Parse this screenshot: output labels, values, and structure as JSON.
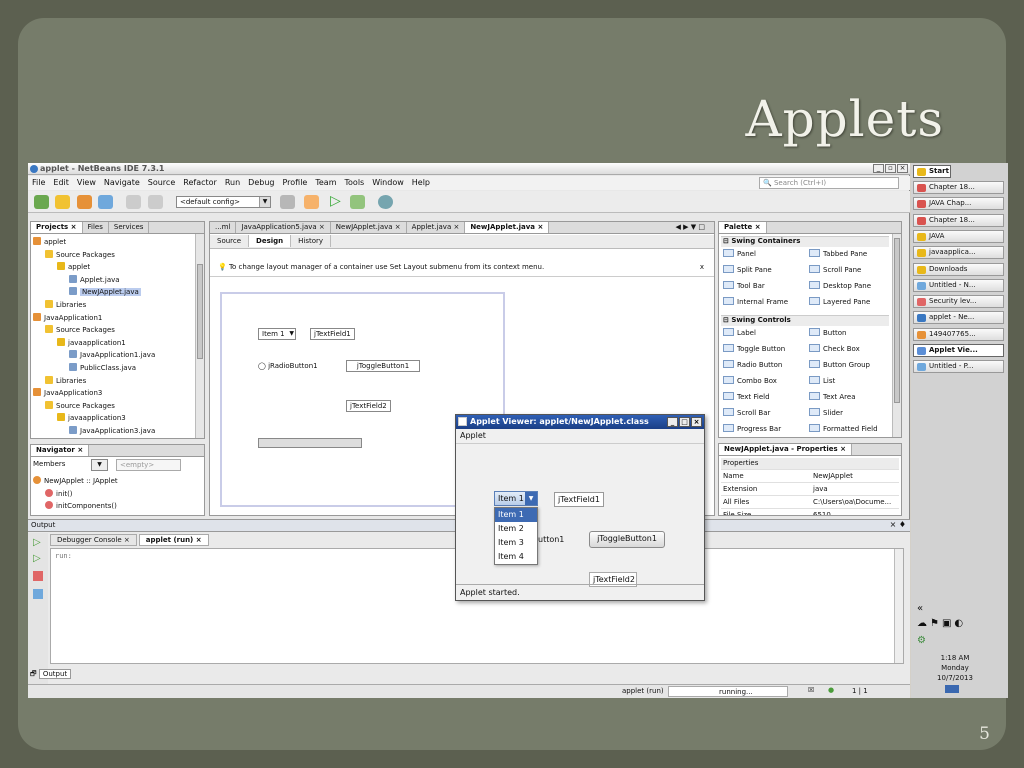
{
  "slide": {
    "title": "Applets",
    "page_number": "5"
  },
  "ide": {
    "window_title": "applet - NetBeans IDE 7.3.1",
    "menu": [
      "File",
      "Edit",
      "View",
      "Navigate",
      "Source",
      "Refactor",
      "Run",
      "Debug",
      "Profile",
      "Team",
      "Tools",
      "Window",
      "Help"
    ],
    "search_placeholder": "Search (Ctrl+I)",
    "config_value": "<default config>",
    "projects": {
      "tabs": [
        "Projects ×",
        "Files",
        "Services"
      ],
      "tree": [
        {
          "label": "applet",
          "depth": 0
        },
        {
          "label": "Source Packages",
          "depth": 1
        },
        {
          "label": "applet",
          "depth": 2
        },
        {
          "label": "Applet.java",
          "depth": 3
        },
        {
          "label": "NewJApplet.java",
          "depth": 3,
          "selected": true
        },
        {
          "label": "Libraries",
          "depth": 1
        },
        {
          "label": "JavaApplication1",
          "depth": 0
        },
        {
          "label": "Source Packages",
          "depth": 1
        },
        {
          "label": "javaapplication1",
          "depth": 2
        },
        {
          "label": "JavaApplication1.java",
          "depth": 3
        },
        {
          "label": "PublicClass.java",
          "depth": 3
        },
        {
          "label": "Libraries",
          "depth": 1
        },
        {
          "label": "JavaApplication3",
          "depth": 0
        },
        {
          "label": "Source Packages",
          "depth": 1
        },
        {
          "label": "javaapplication3",
          "depth": 2
        },
        {
          "label": "JavaApplication3.java",
          "depth": 3
        }
      ]
    },
    "navigator": {
      "title": "Navigator ×",
      "members_label": "Members",
      "filter_value": "<empty>",
      "items": [
        "NewJApplet :: JApplet",
        "init()",
        "initComponents()"
      ]
    },
    "editor": {
      "tabs": [
        "...ml",
        "JavaApplication5.java ×",
        "NewJApplet.java ×",
        "Applet.java ×",
        "NewJApplet.java ×"
      ],
      "mode_tabs": [
        "Source",
        "Design",
        "History"
      ],
      "hint": "To change layout manager of a container use Set Layout submenu from its context menu.",
      "hint_close": "x",
      "design": {
        "combo": "Item 1",
        "textfield1": "jTextField1",
        "radio": "jRadioButton1",
        "toggle": "jToggleButton1",
        "textfield2": "jTextField2"
      }
    },
    "palette": {
      "title": "Palette ×",
      "sections": [
        {
          "name": "Swing Containers",
          "items": [
            "Panel",
            "Tabbed Pane",
            "Split Pane",
            "Scroll Pane",
            "Tool Bar",
            "Desktop Pane",
            "Internal Frame",
            "Layered Pane"
          ]
        },
        {
          "name": "Swing Controls",
          "items": [
            "Label",
            "Button",
            "Toggle Button",
            "Check Box",
            "Radio Button",
            "Button Group",
            "Combo Box",
            "List",
            "Text Field",
            "Text Area",
            "Scroll Bar",
            "Slider",
            "Progress Bar",
            "Formatted Field"
          ]
        }
      ]
    },
    "properties": {
      "title": "NewJApplet.java - Properties ×",
      "section": "Properties",
      "rows": [
        {
          "name": "Name",
          "value": "NewJApplet"
        },
        {
          "name": "Extension",
          "value": "java"
        },
        {
          "name": "All Files",
          "value": "C:\\Users\\oa\\Docume..."
        },
        {
          "name": "File Size",
          "value": "6510"
        }
      ]
    },
    "output": {
      "title": "Output",
      "tabs": [
        "Debugger Console ×",
        "applet (run) ×"
      ],
      "text": "run:",
      "bottom_tab": "Output"
    },
    "status": {
      "run_label": "applet (run)",
      "state": "running...",
      "pos": "1 | 1"
    }
  },
  "applet_viewer": {
    "title": "Applet Viewer: applet/NewJApplet.class",
    "menu": "Applet",
    "combo_value": "Item 1",
    "options": [
      "Item 1",
      "Item 2",
      "Item 3",
      "Item 4"
    ],
    "selected_index": 0,
    "textfield1": "jTextField1",
    "radio_partial": "utton1",
    "toggle": "jToggleButton1",
    "textfield2": "jTextField2",
    "status": "Applet started."
  },
  "taskbar": {
    "start": "Start",
    "items": [
      "Chapter 18...",
      "JAVA Chap...",
      "Chapter 18...",
      "JAVA",
      "javaapplica...",
      "Downloads",
      "Untitled - N...",
      "Security lev...",
      "applet - Ne...",
      "149407765...",
      "Applet Vie...",
      "Untitled - P..."
    ],
    "active_index": 10,
    "clock": {
      "time": "1:18 AM",
      "day": "Monday",
      "date": "10/7/2013"
    },
    "chevron": "«"
  }
}
